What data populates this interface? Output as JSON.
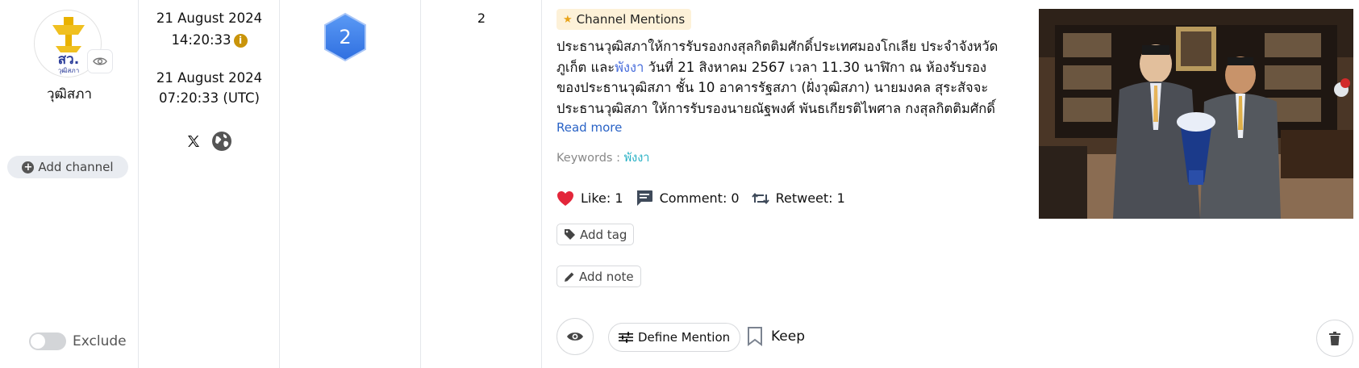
{
  "channel": {
    "name": "วุฒิสภา",
    "logo_text": "สว.",
    "logo_subtext": "วุฒิสภา",
    "add_channel_label": "Add channel",
    "exclude_label": "Exclude"
  },
  "datetime": {
    "local_date": "21 August 2024",
    "local_time": "14:20:33",
    "utc_date": "21 August 2024",
    "utc_time": "07:20:33 (UTC)",
    "info_icon": "i"
  },
  "sources": [
    "x-icon",
    "globe-icon"
  ],
  "rank": {
    "value": "2"
  },
  "count": {
    "value": "2"
  },
  "post": {
    "badge_label": "Channel Mentions",
    "text_before": "ประธานวุฒิสภาให้การรับรองกงสุลกิตติมศักดิ์ประเทศมองโกเลีย ประจำจังหวัดภูเก็ต และ",
    "keyword": "พังงา",
    "text_after": " วันที่ 21 สิงหาคม 2567 เวลา 11.30 นาฬิกา ณ ห้องรับรองของประธานวุฒิสภา ชั้น 10 อาคารรัฐสภา (ฝั่งวุฒิสภา) นายมงคล สุระสัจจะ ประธานวุฒิสภา ให้การรับรองนายณัฐพงศ์ พันธเกียรติไพศาล กงสุลกิตติมศักดิ์ประเทศ…",
    "read_more": "Read more",
    "keywords_label": "Keywords :",
    "keywords_value": "พังงา",
    "like_label": "Like: 1",
    "comment_label": "Comment: 0",
    "retweet_label": "Retweet: 1",
    "add_tag": "Add tag",
    "add_note": "Add note",
    "define_mention": "Define Mention",
    "keep": "Keep"
  },
  "colors": {
    "accent_blue": "#3f82f0",
    "like_red": "#e3263a",
    "badge_bg": "#fdf1d8",
    "keyword_teal": "#25b0c4"
  }
}
